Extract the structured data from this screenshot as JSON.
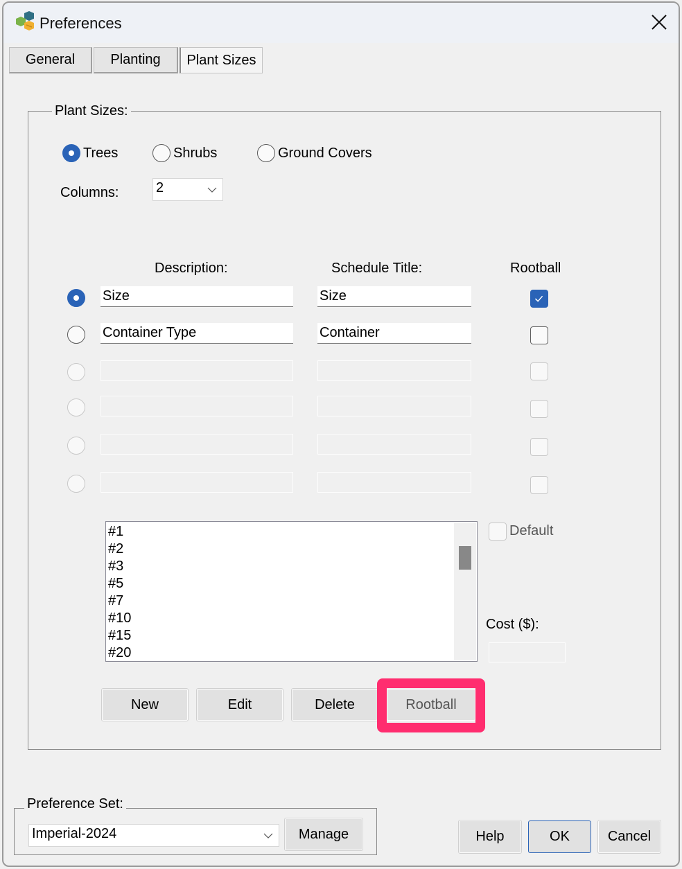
{
  "window": {
    "title": "Preferences",
    "icons": {
      "app": "garden-hexagon-logo-icon",
      "close": "close-icon"
    }
  },
  "tabs": [
    {
      "label": "General",
      "active": false
    },
    {
      "label": "Planting",
      "active": false
    },
    {
      "label": "Plant Sizes",
      "active": true
    }
  ],
  "plant_sizes": {
    "group_label": "Plant Sizes:",
    "categories": [
      {
        "label": "Trees",
        "selected": true
      },
      {
        "label": "Shrubs",
        "selected": false
      },
      {
        "label": "Ground Covers",
        "selected": false
      }
    ],
    "columns_label": "Columns:",
    "columns_value": "2",
    "headers": {
      "description": "Description:",
      "schedule_title": "Schedule Title:",
      "rootball": "Rootball"
    },
    "rows": [
      {
        "selected": true,
        "description": "Size",
        "schedule_title": "Size",
        "rootball": true,
        "enabled": true
      },
      {
        "selected": false,
        "description": "Container Type",
        "schedule_title": "Container",
        "rootball": false,
        "enabled": true
      },
      {
        "selected": false,
        "description": "",
        "schedule_title": "",
        "rootball": false,
        "enabled": false
      },
      {
        "selected": false,
        "description": "",
        "schedule_title": "",
        "rootball": false,
        "enabled": false
      },
      {
        "selected": false,
        "description": "",
        "schedule_title": "",
        "rootball": false,
        "enabled": false
      },
      {
        "selected": false,
        "description": "",
        "schedule_title": "",
        "rootball": false,
        "enabled": false
      }
    ],
    "size_list": [
      "#1",
      "#2",
      "#3",
      "#5",
      "#7",
      "#10",
      "#15",
      "#20"
    ],
    "default_label": "Default",
    "default_checked": false,
    "cost_label": "Cost ($):",
    "cost_value": "",
    "buttons": {
      "new": "New",
      "edit": "Edit",
      "delete": "Delete",
      "rootball": "Rootball"
    },
    "highlight_color": "#ff2d6f"
  },
  "preference_set": {
    "group_label": "Preference Set:",
    "value": "Imperial-2024",
    "manage": "Manage"
  },
  "footer": {
    "help": "Help",
    "ok": "OK",
    "cancel": "Cancel"
  },
  "colors": {
    "accent": "#2a63b7",
    "background": "#f0f0f0"
  }
}
